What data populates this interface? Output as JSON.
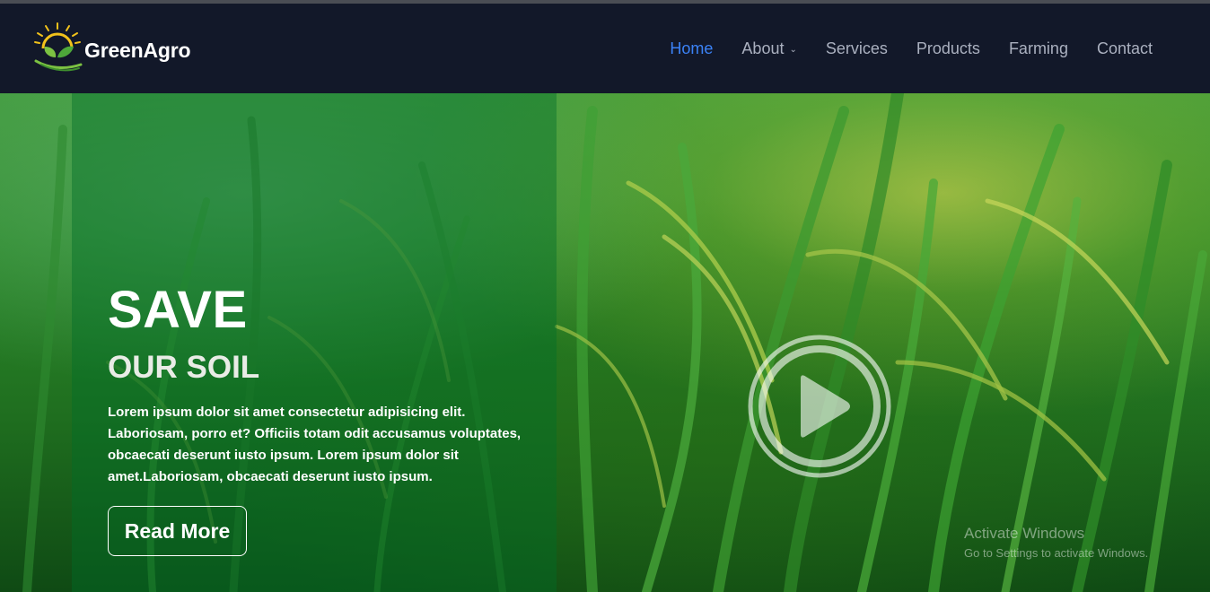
{
  "brand": {
    "name": "GreenAgro"
  },
  "nav": {
    "items": [
      {
        "label": "Home",
        "active": true
      },
      {
        "label": "About",
        "dropdown": true
      },
      {
        "label": "Services"
      },
      {
        "label": "Products"
      },
      {
        "label": "Farming"
      },
      {
        "label": "Contact"
      }
    ]
  },
  "hero": {
    "title": "SAVE",
    "subtitle": "OUR SOIL",
    "text": "Lorem ipsum dolor sit amet consectetur adipisicing elit. Laboriosam, porro et? Officiis totam odit accusamus voluptates, obcaecati deserunt iusto ipsum. Lorem ipsum dolor sit amet.Laboriosam, obcaecati deserunt iusto ipsum.",
    "button_label": "Read More",
    "play_icon": "play-icon"
  },
  "watermark": {
    "title": "Activate Windows",
    "subtitle": "Go to Settings to activate Windows."
  },
  "colors": {
    "nav_bg": "#121829",
    "nav_active": "#3b82f6",
    "nav_text": "#aab0bf",
    "panel_tint": "#006e28"
  }
}
